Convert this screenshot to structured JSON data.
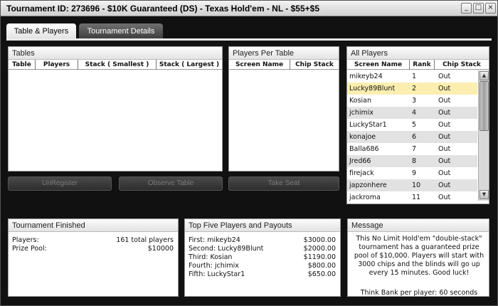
{
  "window": {
    "title": "Tournament ID: 273696 - $10K Guaranteed (DS) - Texas Hold'em - NL - $55+$5",
    "min_symbol": "_",
    "max_symbol": "□",
    "close_symbol": "×"
  },
  "tabs": [
    {
      "label": "Table & Players"
    },
    {
      "label": "Tournament Details"
    }
  ],
  "tables_panel": {
    "title": "Tables",
    "columns": [
      "Table",
      "Players",
      "Stack ( Smallest )",
      "Stack ( Largest )"
    ]
  },
  "players_per_table": {
    "title": "Players Per Table",
    "columns": [
      "Screen Name",
      "Chip Stack"
    ]
  },
  "all_players": {
    "title": "All Players",
    "columns": [
      "Screen Name",
      "Rank",
      "Chip Stack"
    ],
    "rows": [
      {
        "name": "mikeyb24",
        "rank": "1",
        "chips": "Out"
      },
      {
        "name": "Lucky89Blunt",
        "rank": "2",
        "chips": "Out"
      },
      {
        "name": "Kosian",
        "rank": "3",
        "chips": "Out"
      },
      {
        "name": "jchimix",
        "rank": "4",
        "chips": "Out"
      },
      {
        "name": "LuckyStar1",
        "rank": "5",
        "chips": "Out"
      },
      {
        "name": "konajoe",
        "rank": "6",
        "chips": "Out"
      },
      {
        "name": "Balla686",
        "rank": "7",
        "chips": "Out"
      },
      {
        "name": "Jred66",
        "rank": "8",
        "chips": "Out"
      },
      {
        "name": "firejack",
        "rank": "9",
        "chips": "Out"
      },
      {
        "name": "japzonhere",
        "rank": "10",
        "chips": "Out"
      },
      {
        "name": "jackroma",
        "rank": "11",
        "chips": "Out"
      }
    ],
    "selected_row": 1
  },
  "buttons": {
    "unregister": "UnRegister",
    "observe": "Observe Table",
    "take_seat": "Take Seat"
  },
  "tournament_finished": {
    "title": "Tournament Finished",
    "players_label": "Players:",
    "players_value": "161 total players",
    "prize_label": "Prize Pool:",
    "prize_value": "$10000"
  },
  "top_five": {
    "title": "Top Five Players and Payouts",
    "rows": [
      {
        "label": "First: mikeyb24",
        "payout": "$3000.00"
      },
      {
        "label": "Second: Lucky89Blunt",
        "payout": "$2000.00"
      },
      {
        "label": "Third: Kosian",
        "payout": "$1190.00"
      },
      {
        "label": "Fourth: jchimix",
        "payout": "$800.00"
      },
      {
        "label": "Fifth: LuckyStar1",
        "payout": "$650.00"
      }
    ]
  },
  "message": {
    "title": "Message",
    "text": "This No Limit Hold'em \"double-stack\" tournament has a guaranteed prize pool of $10,000. Players will start with 3000 chips and the blinds will go up every 15 minutes. Good luck!",
    "think_bank": "Think Bank per player: 60 seconds"
  },
  "colors": {
    "background": "#111111",
    "row_selected": "#fbeeb0",
    "row_alt": "#e2e2e2"
  }
}
